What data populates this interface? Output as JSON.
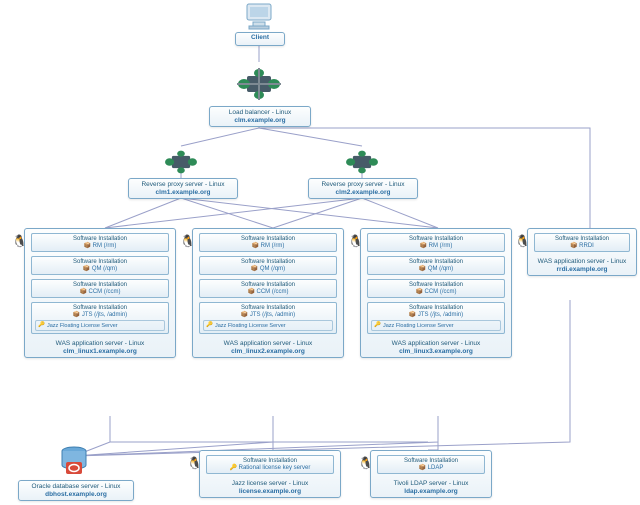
{
  "client": {
    "label": "Client"
  },
  "load_balancer": {
    "title": "Load balancer - Linux",
    "host": "clm.example.org"
  },
  "rp": [
    {
      "title": "Reverse proxy server - Linux",
      "host": "clm1.example.org"
    },
    {
      "title": "Reverse proxy server - Linux",
      "host": "clm2.example.org"
    }
  ],
  "was": [
    {
      "title": "WAS application server - Linux",
      "host": "clm_linux1.example.org",
      "installs": [
        {
          "t": "Software Installation",
          "v": "RM (/rm)"
        },
        {
          "t": "Software Installation",
          "v": "QM (/qm)"
        },
        {
          "t": "Software Installation",
          "v": "CCM (/ccm)"
        },
        {
          "t": "Software Installation",
          "v": "JTS (/jts, /admin)",
          "extra": "Jazz Floating License Server"
        }
      ]
    },
    {
      "title": "WAS application server - Linux",
      "host": "clm_linux2.example.org",
      "installs": [
        {
          "t": "Software Installation",
          "v": "RM (/rm)"
        },
        {
          "t": "Software Installation",
          "v": "QM (/qm)"
        },
        {
          "t": "Software Installation",
          "v": "CCM (/ccm)"
        },
        {
          "t": "Software Installation",
          "v": "JTS (/jts, /admin)",
          "extra": "Jazz Floating License Server"
        }
      ]
    },
    {
      "title": "WAS application server - Linux",
      "host": "clm_linux3.example.org",
      "installs": [
        {
          "t": "Software Installation",
          "v": "RM (/rm)"
        },
        {
          "t": "Software Installation",
          "v": "QM (/qm)"
        },
        {
          "t": "Software Installation",
          "v": "CCM (/ccm)"
        },
        {
          "t": "Software Installation",
          "v": "JTS (/jts, /admin)",
          "extra": "Jazz Floating License Server"
        }
      ]
    }
  ],
  "rrdi": {
    "title": "WAS application server - Linux",
    "host": "rrdi.example.org",
    "install": {
      "t": "Software Installation",
      "v": "RRDI"
    }
  },
  "oracle": {
    "title": "Oracle database server - Linux",
    "host": "dbhost.example.org"
  },
  "license": {
    "title": "Jazz license server - Linux",
    "host": "license.example.org",
    "install": {
      "t": "Software Installation",
      "v": "Rational license key server"
    }
  },
  "ldap": {
    "title": "Tivoli LDAP server - Linux",
    "host": "ldap.example.org",
    "install": {
      "t": "Software Installation",
      "v": "LDAP"
    }
  },
  "colors": {
    "border": "#7ba8c8",
    "accent": "#2b6ea3",
    "wire": "#9aa0c9"
  }
}
